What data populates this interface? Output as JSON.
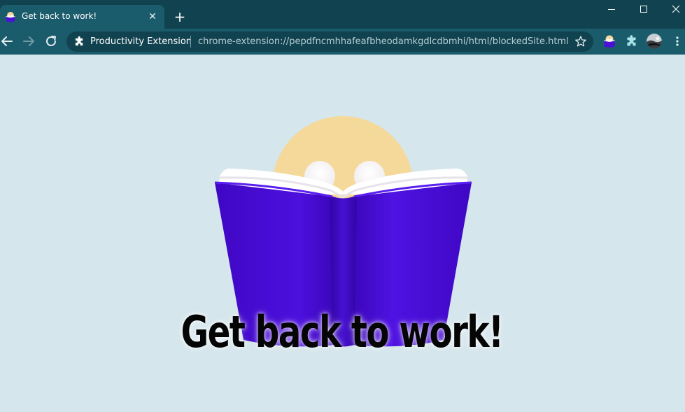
{
  "browser": {
    "tab": {
      "title": "Get back to work!",
      "favicon": "book-reader-icon"
    },
    "new_tab_icon": "plus-icon",
    "window_controls": [
      "minimize-icon",
      "maximize-icon",
      "close-icon"
    ],
    "toolbar": {
      "nav": [
        "back-arrow-icon",
        "forward-arrow-icon",
        "reload-icon"
      ],
      "omnibox": {
        "chip_label": "Productivity Extension",
        "chip_icon": "puzzle-piece-icon",
        "url": "chrome-extension://pepdfncmhhafeafbheodamkgdlcdbmhi/html/blockedSite.html",
        "bookmark_icon": "star-outline-icon"
      },
      "extensions": [
        "book-reader-icon",
        "puzzle-piece-icon"
      ],
      "profile_icon": "avatar-icon",
      "menu_icon": "kebab-menu-icon"
    }
  },
  "page": {
    "headline": "Get back to work!"
  },
  "colors": {
    "tab_strip": "#11424f",
    "toolbar": "#1b5c6c",
    "page_background": "#d5e6ec",
    "book_cover": "#4a10d8",
    "face": "#f5d99b"
  }
}
